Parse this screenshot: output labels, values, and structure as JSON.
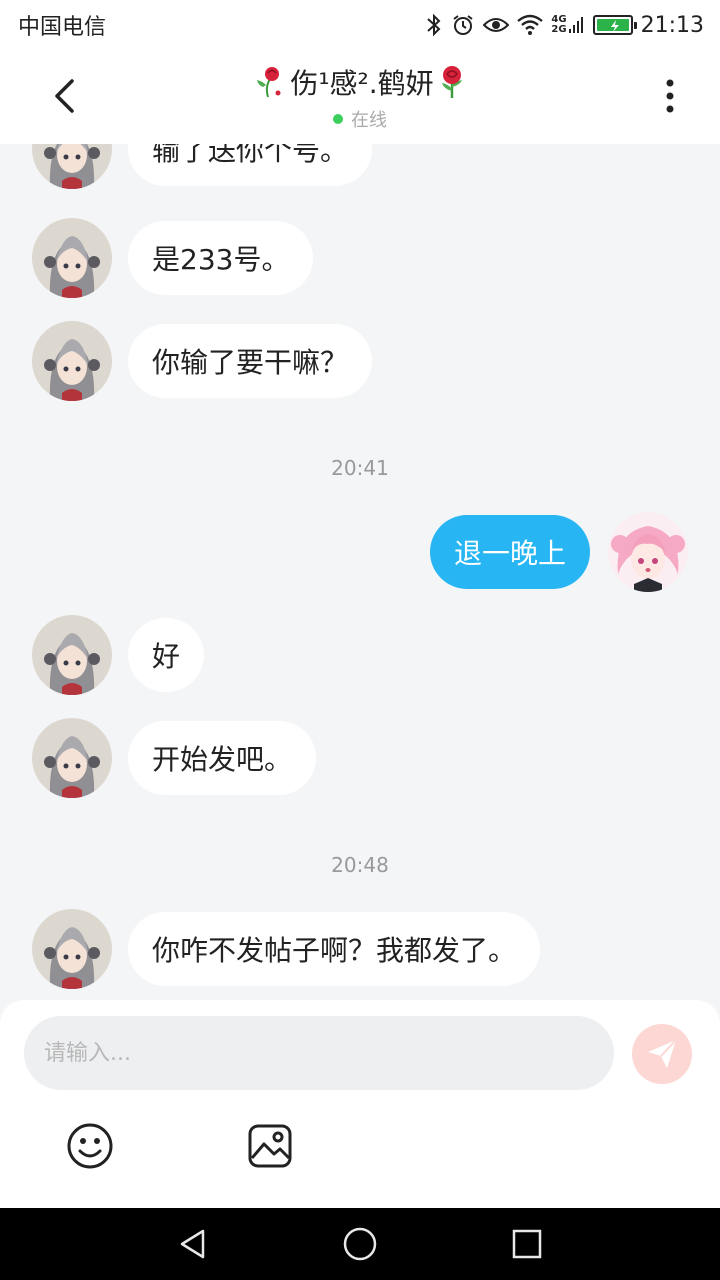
{
  "status_bar": {
    "carrier": "中国电信",
    "network_top": "4G",
    "network_bottom": "2G",
    "time": "21:13"
  },
  "header": {
    "title_name": "伤¹感².鹤妍",
    "status": "在线",
    "accent_online": "#3ccf5e"
  },
  "messages": [
    {
      "side": "left",
      "text": "输了送你个号。"
    },
    {
      "side": "left",
      "text": "是233号。"
    },
    {
      "side": "left",
      "text": "你输了要干嘛？"
    },
    {
      "side": "time",
      "text": "20:41"
    },
    {
      "side": "right",
      "text": "退一晚上"
    },
    {
      "side": "left",
      "text": "好"
    },
    {
      "side": "left",
      "text": "开始发吧。"
    },
    {
      "side": "time",
      "text": "20:48"
    },
    {
      "side": "left",
      "text": "你咋不发帖子啊？我都发了。"
    }
  ],
  "input": {
    "placeholder": "请输入..."
  },
  "icons": {
    "back": "chevron-left-icon",
    "more": "more-vertical-icon",
    "send": "send-icon",
    "emoji": "emoji-icon",
    "image": "image-icon",
    "nav_back": "triangle-back-icon",
    "nav_home": "circle-home-icon",
    "nav_recent": "square-recent-icon"
  },
  "colors": {
    "bubble_right": "#27b5f3",
    "send_button": "#fcd7d3",
    "battery": "#2bb34a"
  }
}
